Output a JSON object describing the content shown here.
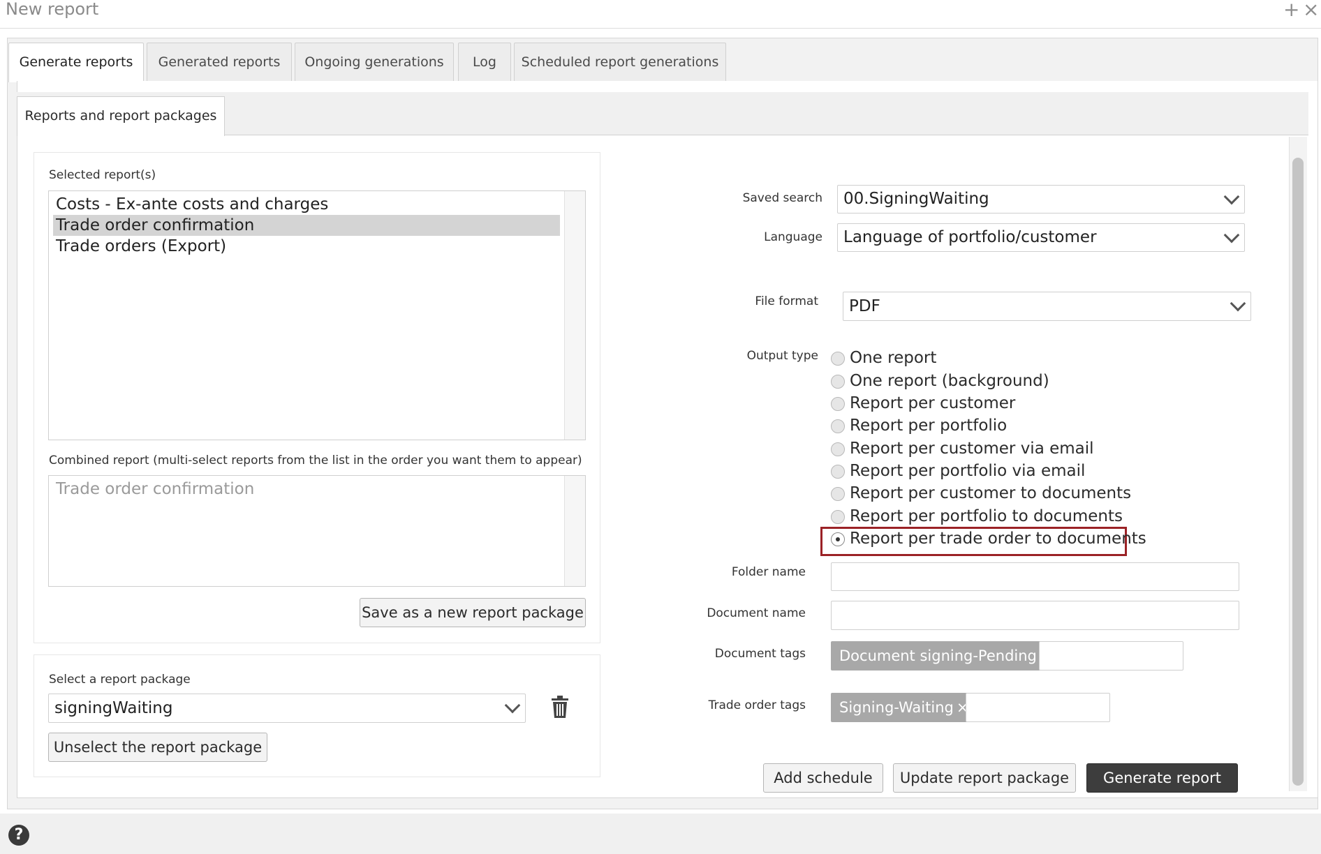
{
  "window": {
    "title": "New report",
    "add_glyph": "+",
    "close_glyph": "×"
  },
  "tabs": [
    {
      "label": "Generate reports",
      "active": true
    },
    {
      "label": "Generated reports",
      "active": false
    },
    {
      "label": "Ongoing generations",
      "active": false
    },
    {
      "label": "Log",
      "active": false
    },
    {
      "label": "Scheduled report generations",
      "active": false
    }
  ],
  "subtab": {
    "label": "Reports and report packages"
  },
  "left": {
    "selected_reports_label": "Selected report(s)",
    "selected_reports": [
      {
        "label": "Costs - Ex-ante costs and charges",
        "selected": false
      },
      {
        "label": "Trade order confirmation",
        "selected": true
      },
      {
        "label": "Trade orders (Export)",
        "selected": false
      }
    ],
    "combined_label": "Combined report (multi-select reports from the list in the order you want them to appear)",
    "combined_items": [
      "Trade order confirmation"
    ],
    "save_package_button": "Save as a new report package",
    "select_package_label": "Select a report package",
    "package_value": "signingWaiting",
    "unselect_button": "Unselect the report package",
    "delete_icon": "trash-icon"
  },
  "right": {
    "saved_search_label": "Saved search",
    "saved_search_value": "00.SigningWaiting",
    "language_label": "Language",
    "language_value": "Language of portfolio/customer",
    "file_format_label": "File format",
    "file_format_value": "PDF",
    "output_type_label": "Output type",
    "output_types": [
      {
        "label": "One report",
        "checked": false
      },
      {
        "label": "One report (background)",
        "checked": false
      },
      {
        "label": "Report per customer",
        "checked": false
      },
      {
        "label": "Report per portfolio",
        "checked": false
      },
      {
        "label": "Report per customer via email",
        "checked": false
      },
      {
        "label": "Report per portfolio via email",
        "checked": false
      },
      {
        "label": "Report per customer to documents",
        "checked": false
      },
      {
        "label": "Report per portfolio to documents",
        "checked": false
      },
      {
        "label": "Report per trade order to documents",
        "checked": true
      }
    ],
    "folder_name_label": "Folder name",
    "folder_name_value": "",
    "document_name_label": "Document name",
    "document_name_value": "",
    "document_tags_label": "Document tags",
    "document_tags": [
      "Document signing-Pending"
    ],
    "trade_order_tags_label": "Trade order tags",
    "trade_order_tags": [
      "Signing-Waiting"
    ],
    "tag_remove_glyph": "×",
    "add_schedule_button": "Add schedule",
    "update_package_button": "Update report package",
    "generate_button": "Generate report"
  },
  "footer": {
    "help_glyph": "?"
  },
  "colors": {
    "highlight": "#9b2226",
    "primary_button": "#3d3d3d",
    "tag_bg": "#a8a8a8"
  }
}
